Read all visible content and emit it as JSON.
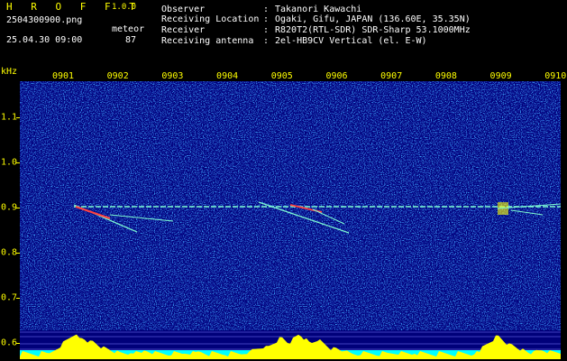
{
  "header": {
    "app_name": "H R O F F T",
    "version": "1.0.0",
    "filename": "2504300900.png",
    "datetime": "25.04.30 09:00",
    "meteor_label": "meteor",
    "meteor_count": "87"
  },
  "info": [
    {
      "label": "Observer",
      "value": "Takanori Kawachi"
    },
    {
      "label": "Receiving Location",
      "value": "Ogaki, Gifu, JAPAN (136.60E, 35.35N)"
    },
    {
      "label": "Receiver",
      "value": "R820T2(RTL-SDR) SDR-Sharp 53.1000MHz"
    },
    {
      "label": "Receiving antenna",
      "value": "2el-HB9CV Vertical (el. E-W)"
    }
  ],
  "spectrogram": {
    "y_unit": "kHz",
    "x_ticks": [
      "0901",
      "0902",
      "0903",
      "0904",
      "0905",
      "0906",
      "0907",
      "0908",
      "0909",
      "0910"
    ],
    "y_ticks": [
      "1.1",
      "1.0",
      "0.9",
      "0.8",
      "0.7",
      "0.6"
    ],
    "y_tick_values": [
      1.1,
      1.0,
      0.9,
      0.8,
      0.7,
      0.6
    ],
    "x_tick_minutes": [
      1,
      2,
      3,
      4,
      5,
      6,
      7,
      8,
      9,
      10
    ],
    "colors": {
      "background": "#00007a",
      "noise": "#1a3cff",
      "carrier": "#7fffd4",
      "echo": "#ff4040",
      "level": "#ffff00",
      "level_base": "#00ffff"
    }
  }
}
